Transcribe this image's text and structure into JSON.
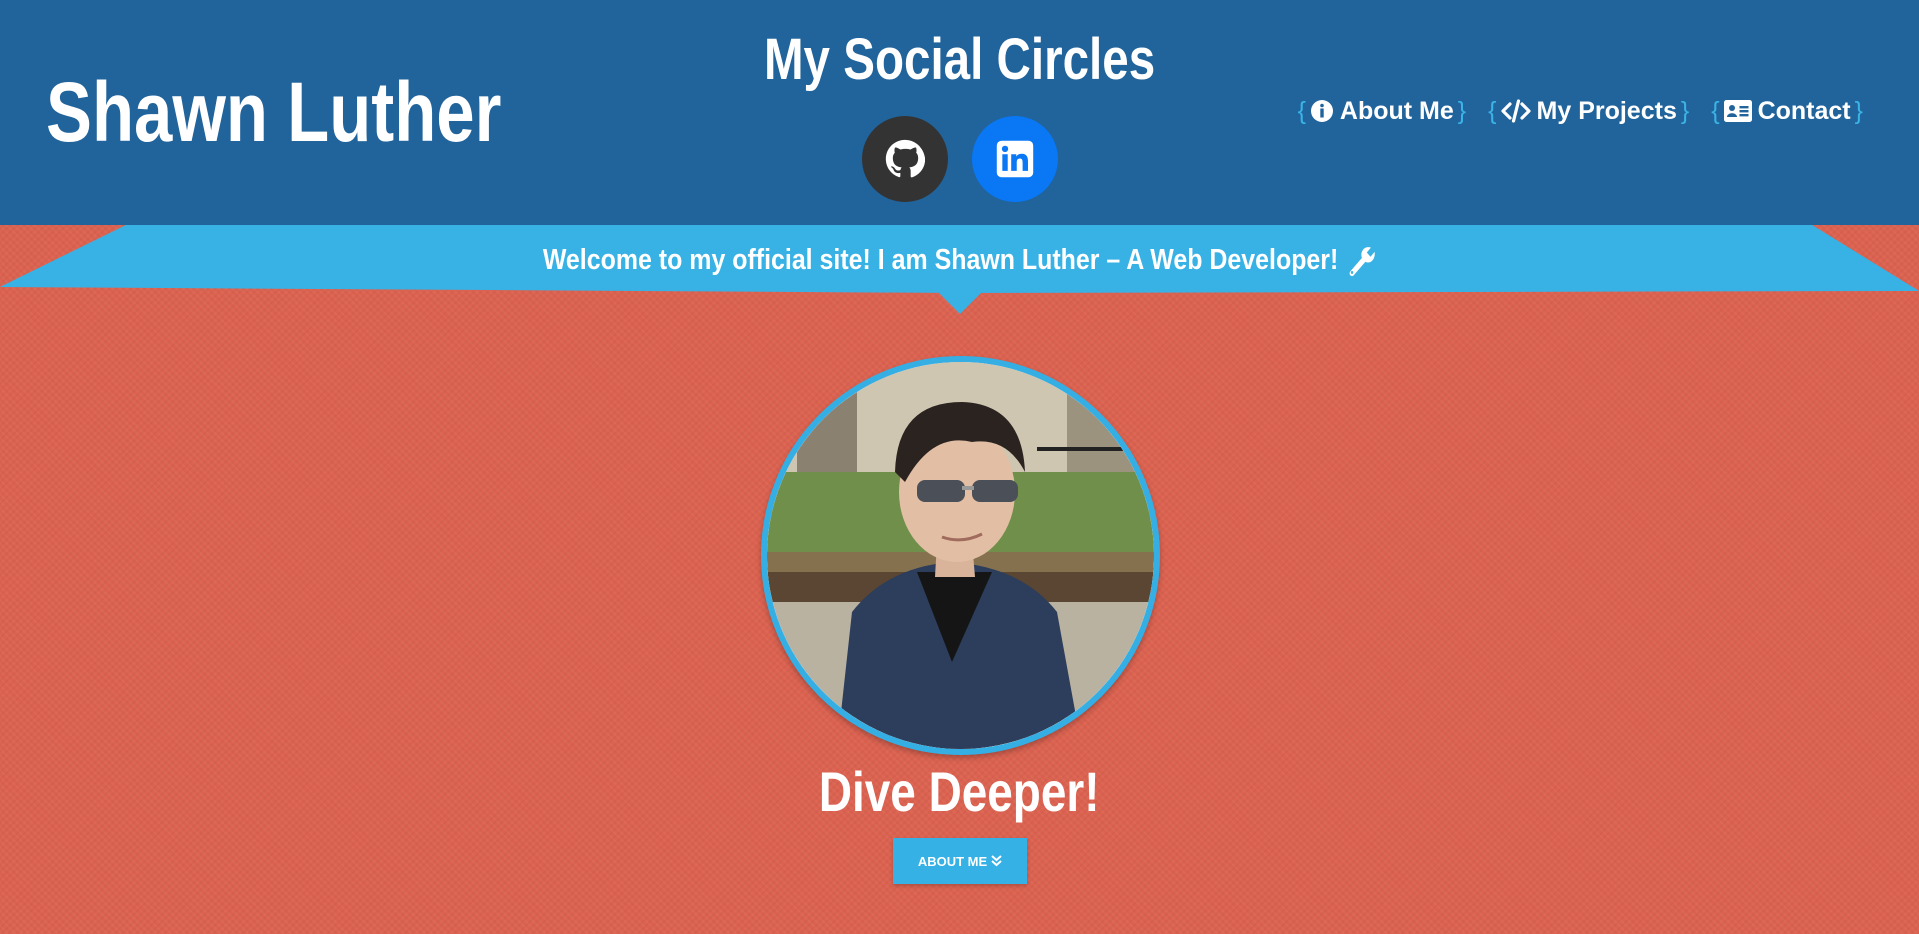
{
  "header": {
    "brand": "Shawn Luther",
    "social_title": "My Social Circles",
    "social_links": [
      {
        "name": "GitHub",
        "icon": "github-icon",
        "color": "#333333"
      },
      {
        "name": "LinkedIn",
        "icon": "linkedin-icon",
        "color": "#0a77f5"
      }
    ],
    "nav": [
      {
        "label": "About Me",
        "icon": "info-icon"
      },
      {
        "label": "My Projects",
        "icon": "code-icon"
      },
      {
        "label": "Contact",
        "icon": "id-card-icon"
      }
    ],
    "brace_open": "{",
    "brace_close": "}"
  },
  "banner": {
    "text": "Welcome to my official site! I am Shawn Luther – A Web Developer!",
    "icon": "wrench-icon"
  },
  "hero": {
    "heading": "Dive Deeper!",
    "button_label": "ABOUT ME",
    "button_icon": "double-chevron-down-icon"
  },
  "colors": {
    "header_bg": "#21639b",
    "banner_bg": "#38b1e5",
    "page_bg": "#dc6250",
    "accent": "#35aee4"
  }
}
